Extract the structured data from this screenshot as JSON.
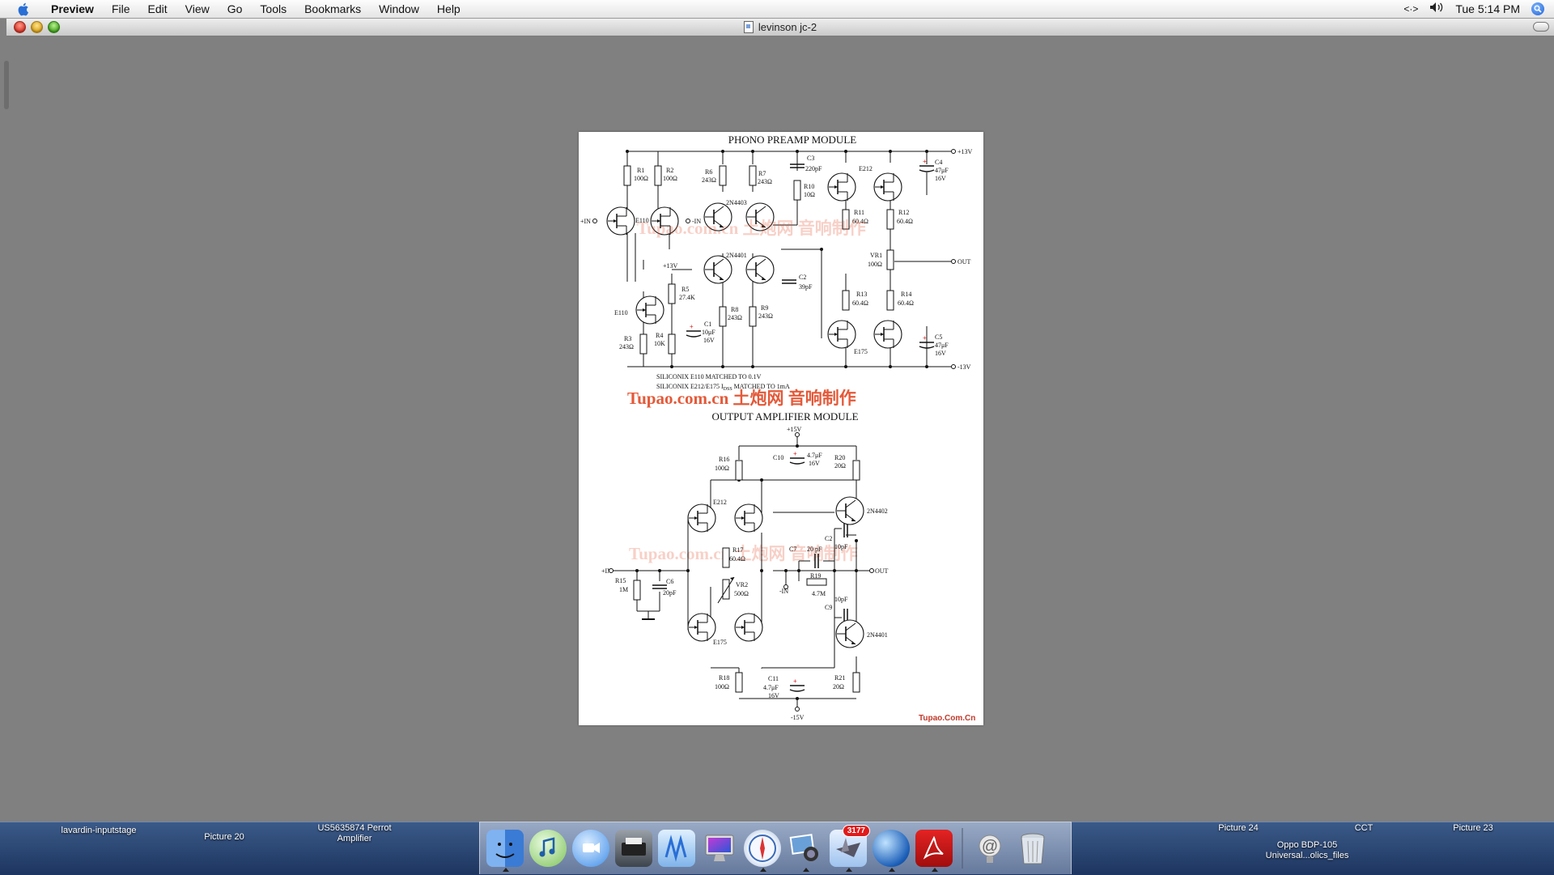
{
  "menubar": {
    "app_name": "Preview",
    "items": [
      "File",
      "Edit",
      "View",
      "Go",
      "Tools",
      "Bookmarks",
      "Window",
      "Help"
    ],
    "status": {
      "clock": "Tue 5:14 PM",
      "sync_icon": "<·>"
    }
  },
  "window": {
    "title": "levinson jc-2"
  },
  "document": {
    "top": {
      "title": "PHONO PREAMP MODULE",
      "rails": {
        "pos": "+13V",
        "neg": "-13V"
      },
      "io": {
        "in_pos": "+IN",
        "in_neg": "-IN",
        "out": "OUT"
      },
      "parts": {
        "r1": "R1",
        "r1v": "100Ω",
        "r2": "R2",
        "r2v": "100Ω",
        "r6": "R6",
        "r6v": "243Ω",
        "r7": "R7",
        "r7v": "243Ω",
        "c3": "C3",
        "c3v": "220pF",
        "r10": "R10",
        "r10v": "10Ω",
        "e212": "E212",
        "c4": "C4",
        "c4v": "47μF",
        "c4u": "16V",
        "r11": "R11",
        "r11v": "60.4Ω",
        "r12": "R12",
        "r12v": "60.4Ω",
        "q_pnp": "2N4403",
        "q_npn": "2N4401",
        "e110a": "E110",
        "e110b": "E110",
        "vr1": "VR1",
        "vr1v": "100Ω",
        "plus13": "+13V",
        "c2": "C2",
        "c2v": "39pF",
        "r5": "R5",
        "r5v": "27.4K",
        "r13": "R13",
        "r13v": "60.4Ω",
        "r14": "R14",
        "r14v": "60.4Ω",
        "r8": "R8",
        "r8v": "243Ω",
        "r9": "R9",
        "r9v": "243Ω",
        "c1": "C1",
        "c1v": "10μF",
        "c1u": "16V",
        "r3": "R3",
        "r3v": "243Ω",
        "r4": "R4",
        "r4v": "10K",
        "e175": "E175",
        "c5": "C5",
        "c5v": "47μF",
        "c5u": "16V"
      },
      "notes": [
        "SILICONIX E110 MATCHED TO 0.1V",
        "SILICONIX E212/E175 I",
        "DSS",
        " MATCHED TO 1mA"
      ]
    },
    "watermark": "Tupao.com.cn 土炮网 音响制作",
    "bottom": {
      "title": "OUTPUT AMPLIFIER  MODULE",
      "rails": {
        "pos": "+15V",
        "neg": "-15V"
      },
      "io": {
        "in_pos": "+IN",
        "in_neg": "-IN",
        "out": "OUT"
      },
      "parts": {
        "r16": "R16",
        "r16v": "100Ω",
        "c10": "C10",
        "c10v": "4.7μF",
        "c10u": "16V",
        "r20": "R20",
        "r20v": "20Ω",
        "e212": "E212",
        "q_pnp": "2N4402",
        "c2": "C2",
        "c2v": "10pF",
        "c7": "C7",
        "c7v": "20 pF",
        "r17": "R17",
        "r17v": "60.4Ω",
        "r19": "R19",
        "r19v": "4.7M",
        "r15": "R15",
        "r15v": "1M",
        "c6": "C6",
        "c6v": "20pF",
        "vr2": "VR2",
        "vr2v": "500Ω",
        "c9": "C9",
        "c9v": "10pF",
        "q_npn": "2N4401",
        "e175": "E175",
        "r18": "R18",
        "r18v": "100Ω",
        "c11": "C11",
        "c11v": "4.7μF",
        "c11u": "16V",
        "r21": "R21",
        "r21v": "20Ω"
      },
      "credit": "Tupao.Com.Cn"
    }
  },
  "desktop": {
    "left_items": [
      "lavardin-inputstage",
      "Picture 20",
      "US5635874 Perrot",
      "Amplifier"
    ],
    "right_items": [
      "Picture 24",
      "CCT",
      "Picture 23",
      "Oppo BDP-105",
      "Universal...olics_files"
    ]
  },
  "dock": {
    "apps": [
      "finder-icon",
      "itunes-icon",
      "ichat-icon",
      "printer-icon",
      "tools-icon",
      "imac-icon",
      "safari-icon",
      "iphoto-icon",
      "mail-stamp-icon",
      "globe-icon",
      "acrobat-icon"
    ],
    "mail_badge": "3177",
    "colors": {
      "dock_tint": "#c8d2e6",
      "badge": "#e01b1b"
    }
  }
}
